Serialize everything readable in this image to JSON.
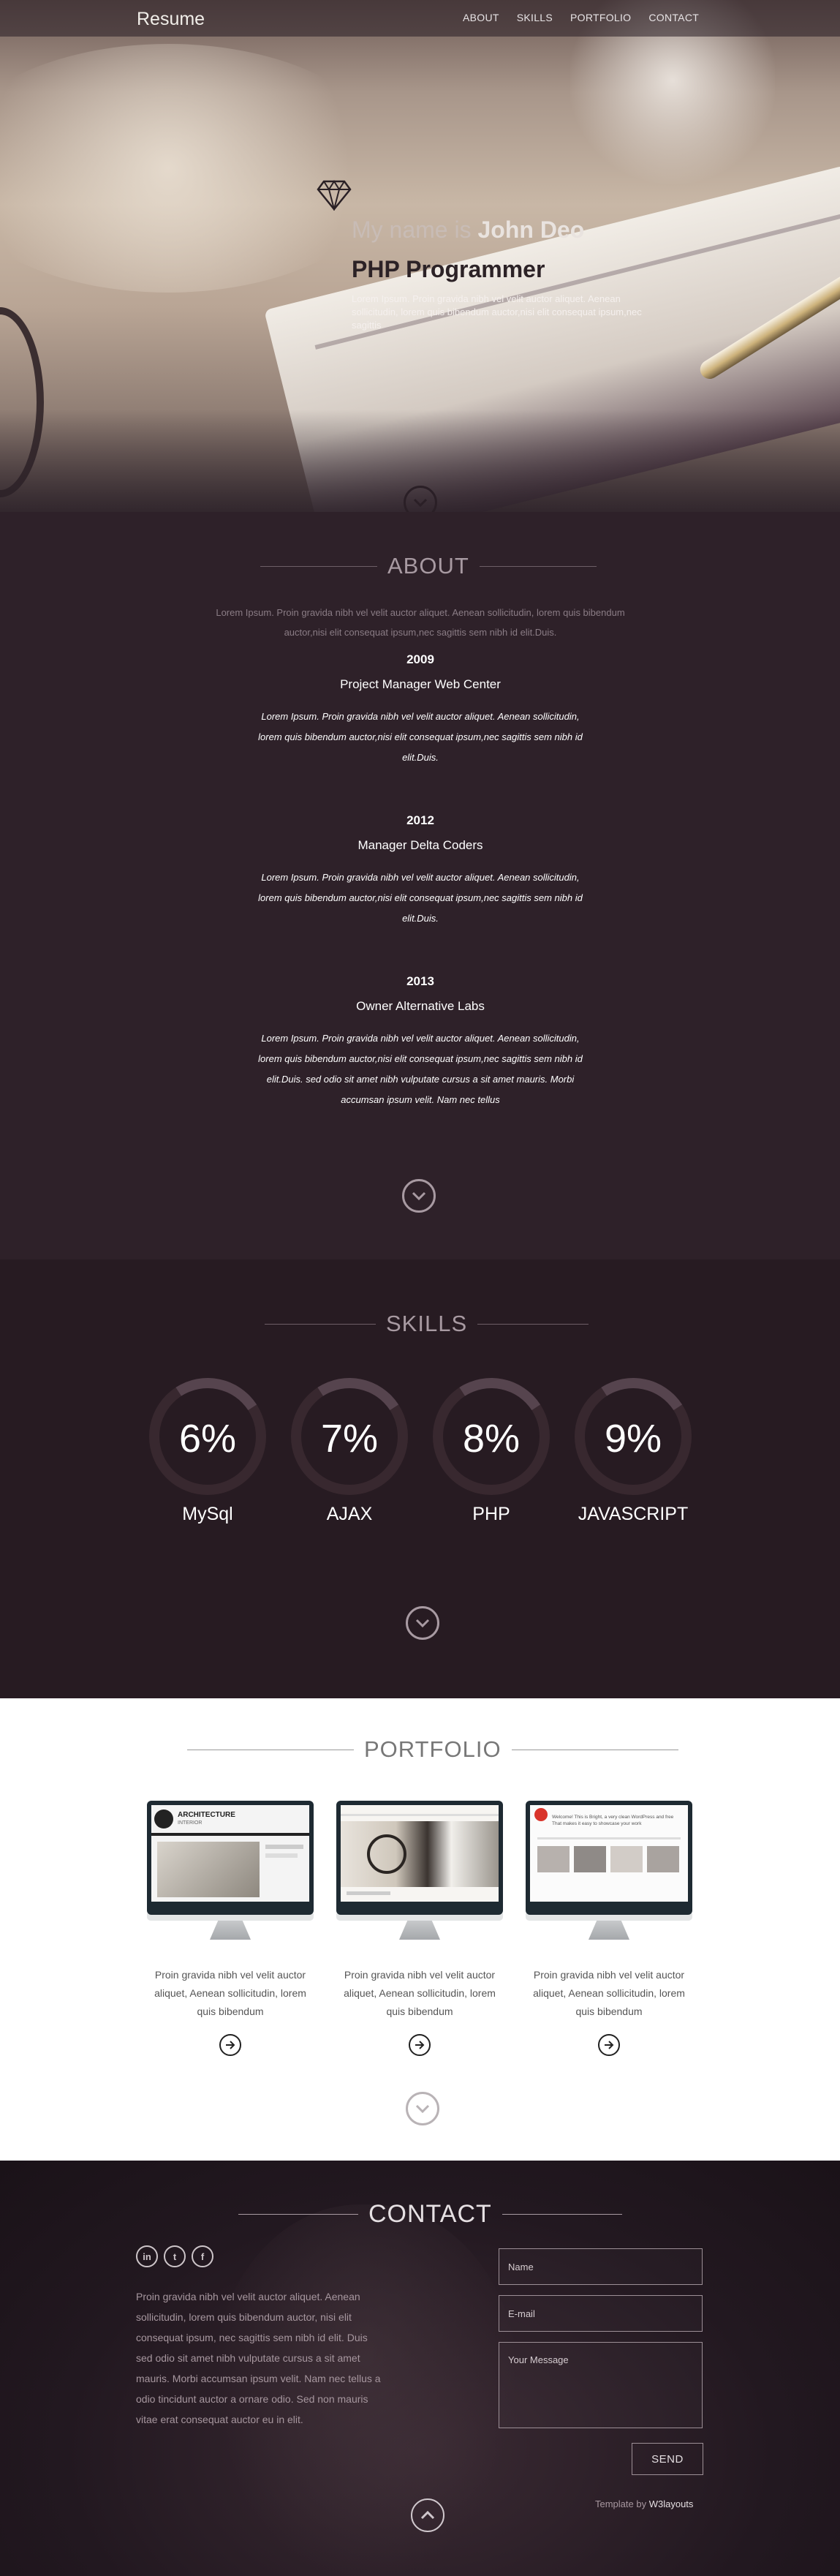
{
  "nav": {
    "brand": "Resume",
    "links": [
      "ABOUT",
      "SKILLS",
      "PORTFOLIO",
      "CONTACT"
    ]
  },
  "hero": {
    "greeting": "My name is",
    "name": "John Deo",
    "role": "PHP Programmer",
    "intro": "Lorem Ipsum. Proin gravida nibh vel velit auctor aliquet. Aenean sollicitudin, lorem quis bibendum auctor,nisi elit consequat ipsum,nec sagittis"
  },
  "about": {
    "title": "ABOUT",
    "lead": "Lorem Ipsum. Proin gravida nibh vel velit auctor aliquet. Aenean sollicitudin, lorem quis bibendum auctor,nisi elit consequat ipsum,nec sagittis sem nibh id elit.Duis.",
    "entries": [
      {
        "year": "2009",
        "position": "Project Manager Web Center",
        "desc": "Lorem Ipsum. Proin gravida nibh vel velit auctor aliquet. Aenean sollicitudin, lorem quis bibendum auctor,nisi elit consequat ipsum,nec sagittis sem nibh id elit.Duis."
      },
      {
        "year": "2012",
        "position": "Manager Delta Coders",
        "desc": "Lorem Ipsum. Proin gravida nibh vel velit auctor aliquet. Aenean sollicitudin, lorem quis bibendum auctor,nisi elit consequat ipsum,nec sagittis sem nibh id elit.Duis."
      },
      {
        "year": "2013",
        "position": "Owner Alternative Labs",
        "desc": "Lorem Ipsum. Proin gravida nibh vel velit auctor aliquet. Aenean sollicitudin, lorem quis bibendum auctor,nisi elit consequat ipsum,nec sagittis sem nibh id elit.Duis. sed odio sit amet nibh vulputate cursus a sit amet mauris. Morbi accumsan ipsum velit. Nam nec tellus"
      }
    ]
  },
  "skills": {
    "title": "SKILLS",
    "items": [
      {
        "percent": "6%",
        "name": "MySql"
      },
      {
        "percent": "7%",
        "name": "AJAX"
      },
      {
        "percent": "8%",
        "name": "PHP"
      },
      {
        "percent": "9%",
        "name": "JAVASCRIPT"
      }
    ]
  },
  "portfolio": {
    "title": "PORTFOLIO",
    "items": [
      {
        "caption": "Proin gravida nibh vel velit auctor aliquet, Aenean sollicitudin, lorem quis bibendum",
        "screen_heading": "ARCHITECTURE",
        "screen_sub": "INTERIOR"
      },
      {
        "caption": "Proin gravida nibh vel velit auctor aliquet, Aenean sollicitudin, lorem quis bibendum",
        "screen_heading": "",
        "screen_sub": ""
      },
      {
        "caption": "Proin gravida nibh vel velit auctor aliquet, Aenean sollicitudin, lorem quis bibendum",
        "screen_heading": "Welcome! This is Bright, a very clean WordPress and free",
        "screen_sub": "That makes it easy to showcase your work"
      }
    ]
  },
  "contact": {
    "title": "CONTACT",
    "social": [
      "in",
      "t",
      "f"
    ],
    "text": "Proin gravida nibh vel velit auctor aliquet. Aenean sollicitudin, lorem quis bibendum auctor, nisi elit consequat ipsum, nec sagittis sem nibh id elit. Duis sed odio sit amet nibh vulputate cursus a sit amet mauris. Morbi accumsan ipsum velit. Nam nec tellus a odio tincidunt auctor a ornare odio. Sed non mauris vitae erat consequat auctor eu in elit.",
    "name_placeholder": "Name",
    "email_placeholder": "E-mail",
    "message_placeholder": "Your Message",
    "send_label": "SEND",
    "credit_prefix": "Template by",
    "credit_link": "W3layouts"
  },
  "colors": {
    "dark_bg": "#2e2129",
    "darker_bg": "#271b22",
    "ring_track": "#38282f",
    "portfolio_bg": "#ffffff"
  }
}
